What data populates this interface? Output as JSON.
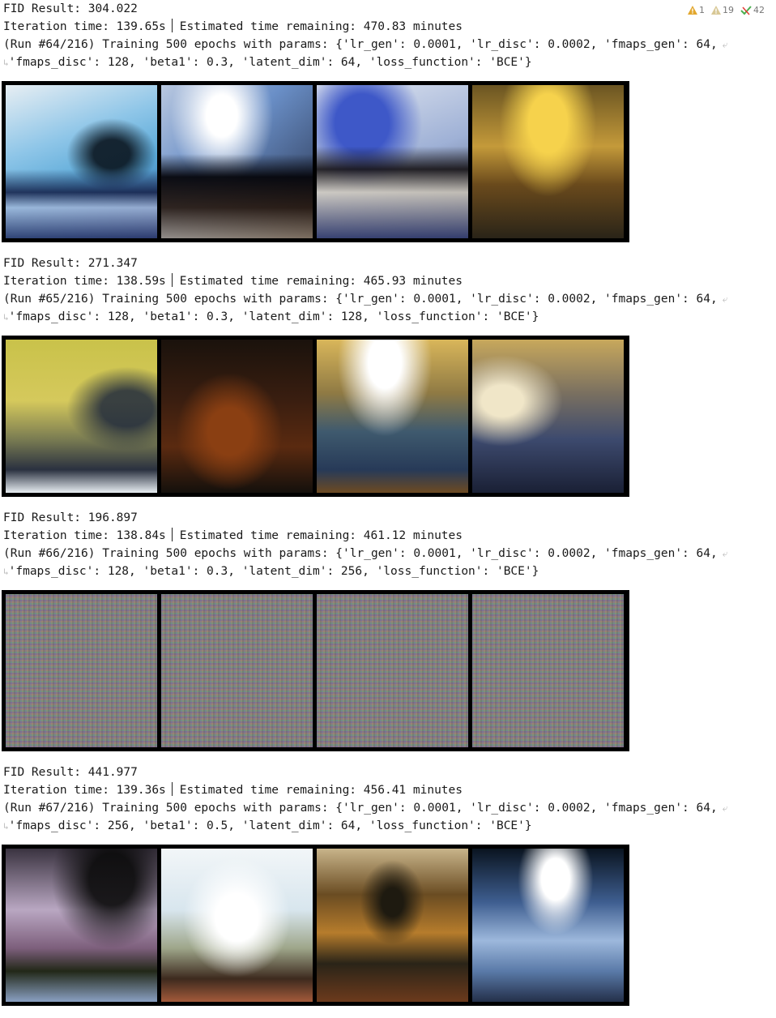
{
  "status_badges": {
    "warnings": "1",
    "weak_warnings": "19",
    "checks": "42"
  },
  "runs": [
    {
      "fid_line": "FID Result: 304.022",
      "iteration_time": "Iteration time: 139.65s",
      "estimated_remaining": "Estimated time remaining: 470.83 minutes",
      "params_line_1": "(Run #64/216) Training 500 epochs with params: {'lr_gen': 0.0001, 'lr_disc': 0.0002, 'fmaps_gen': 64,",
      "params_line_2": "'fmaps_disc': 128, 'beta1': 0.3, 'latent_dim': 64, 'loss_function': 'BCE'}"
    },
    {
      "fid_line": "FID Result: 271.347",
      "iteration_time": "Iteration time: 138.59s",
      "estimated_remaining": "Estimated time remaining: 465.93 minutes",
      "params_line_1": "(Run #65/216) Training 500 epochs with params: {'lr_gen': 0.0001, 'lr_disc': 0.0002, 'fmaps_gen': 64,",
      "params_line_2": "'fmaps_disc': 128, 'beta1': 0.3, 'latent_dim': 128, 'loss_function': 'BCE'}"
    },
    {
      "fid_line": "FID Result: 196.897",
      "iteration_time": "Iteration time: 138.84s",
      "estimated_remaining": "Estimated time remaining: 461.12 minutes",
      "params_line_1": "(Run #66/216) Training 500 epochs with params: {'lr_gen': 0.0001, 'lr_disc': 0.0002, 'fmaps_gen': 64,",
      "params_line_2": "'fmaps_disc': 128, 'beta1': 0.3, 'latent_dim': 256, 'loss_function': 'BCE'}"
    },
    {
      "fid_line": "FID Result: 441.977",
      "iteration_time": "Iteration time: 139.36s",
      "estimated_remaining": "Estimated time remaining: 456.41 minutes",
      "params_line_1": "(Run #67/216) Training 500 epochs with params: {'lr_gen': 0.0001, 'lr_disc': 0.0002, 'fmaps_gen': 64,",
      "params_line_2": "'fmaps_disc': 256, 'beta1': 0.5, 'latent_dim': 64, 'loss_function': 'BCE'}"
    }
  ],
  "icons": {
    "warning": "warning-icon",
    "weak_warning": "weak-warning-icon",
    "check": "check-icon",
    "soft_wrap": "soft-wrap-icon",
    "wrap_continuation": "wrap-continuation-icon"
  },
  "colors": {
    "warning": "#e2a72e",
    "weak_warning": "#c9b27a",
    "check": "#4caf50"
  }
}
